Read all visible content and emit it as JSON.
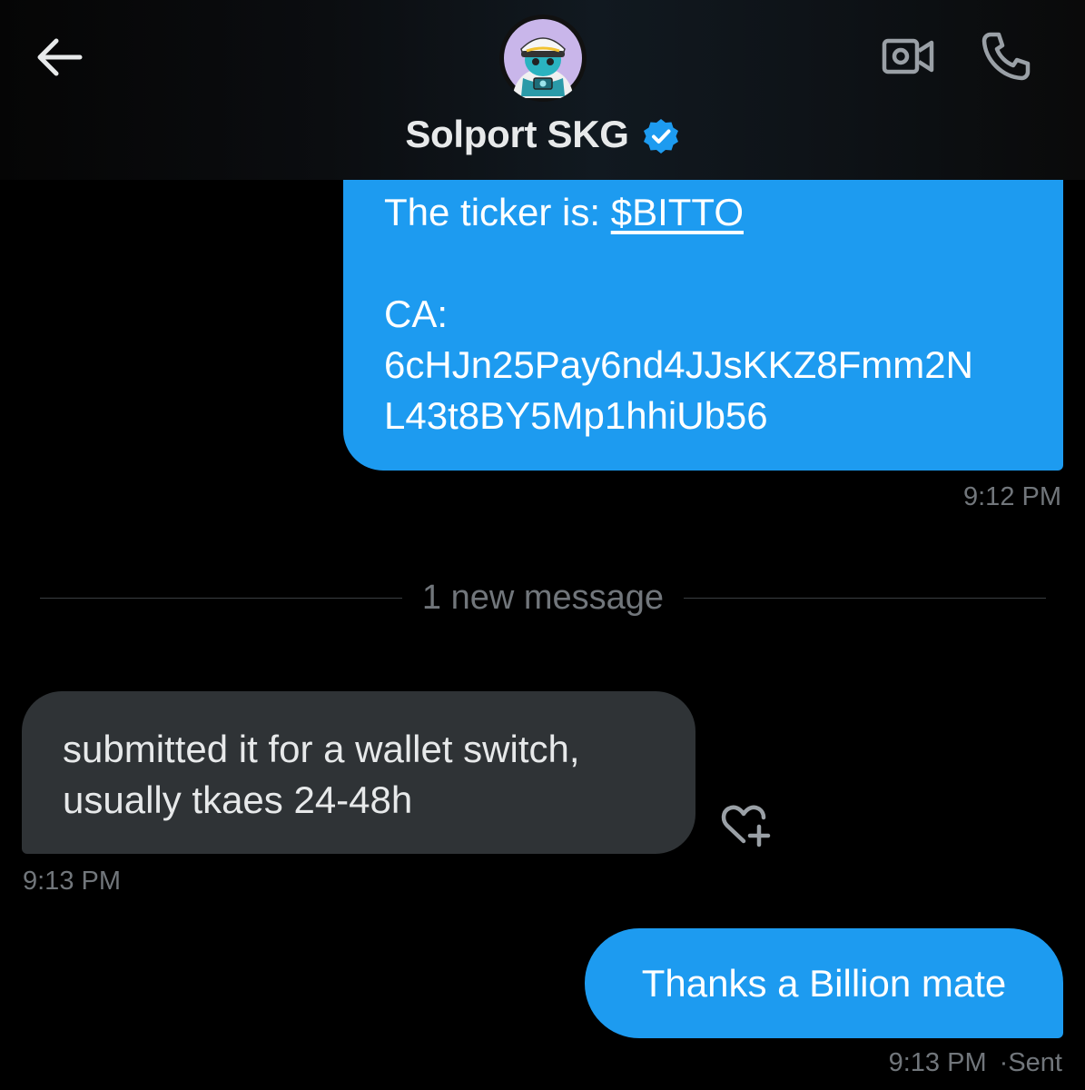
{
  "header": {
    "contact_name": "Solport SKG",
    "verified": true,
    "accent_color": "#1d9bf0",
    "icons": [
      "back-arrow-icon",
      "video-camera-icon",
      "phone-icon",
      "verified-badge-icon"
    ]
  },
  "messages": {
    "ca_message": {
      "ticker_prefix": "The ticker is: ",
      "ticker_link": "$BITTO",
      "ca_label": "CA:",
      "ca_line1": "6cHJn25Pay6nd4JJsKKZ8Fmm2N",
      "ca_line2": "L43t8BY5Mp1hhiUb56",
      "time": "9:12 PM"
    },
    "divider": "1 new message",
    "reply": {
      "line1": "submitted it for a wallet switch,",
      "line2": "usually tkaes 24-48h",
      "time": "9:13 PM"
    },
    "thanks": {
      "text": "Thanks a Billion mate",
      "time": "9:13 PM",
      "status": "·Sent"
    }
  },
  "colors": {
    "sent_bubble": "#1d9bf0",
    "received_bubble": "#2f3336",
    "secondary_text": "#71767b",
    "background": "#000000"
  }
}
